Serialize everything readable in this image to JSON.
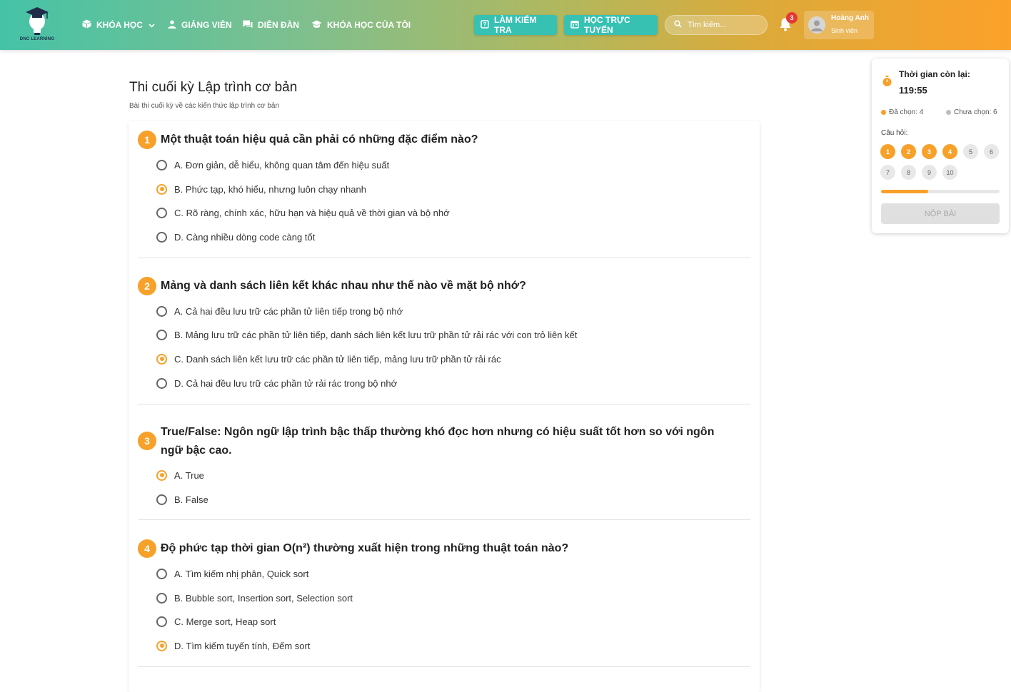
{
  "header": {
    "logo_text": "DNC LEARNING",
    "nav": [
      {
        "label": "KHÓA HỌC",
        "icon": "box-icon",
        "has_dropdown": true
      },
      {
        "label": "GIẢNG VIÊN",
        "icon": "person-icon"
      },
      {
        "label": "DIỄN ĐÀN",
        "icon": "forum-icon"
      },
      {
        "label": "KHÓA HỌC CỦA TÔI",
        "icon": "school-icon"
      }
    ],
    "test_button": "LÀM KIỂM TRA",
    "online_button": "HỌC TRỰC TUYẾN",
    "search_placeholder": "Tìm kiếm...",
    "notifications_count": "3",
    "user": {
      "name": "Hoàng Anh",
      "role": "Sinh viên"
    }
  },
  "exam": {
    "title": "Thi cuối kỳ Lập trình cơ bản",
    "subtitle": "Bài thi cuối kỳ về các kiến thức lập trình cơ bản"
  },
  "questions": [
    {
      "num": "1",
      "text": "Một thuật toán hiệu quả cần phải có những đặc điểm nào?",
      "options": [
        "A. Đơn giản, dễ hiểu, không quan tâm đến hiệu suất",
        "B. Phức tạp, khó hiểu, nhưng luôn chạy nhanh",
        "C. Rõ ràng, chính xác, hữu hạn và hiệu quả về thời gian và bộ nhớ",
        "D. Càng nhiều dòng code càng tốt"
      ],
      "selected": 1
    },
    {
      "num": "2",
      "text": "Mảng và danh sách liên kết khác nhau như thế nào về mặt bộ nhớ?",
      "options": [
        "A. Cả hai đều lưu trữ các phần tử liên tiếp trong bộ nhớ",
        "B. Mảng lưu trữ các phần tử liên tiếp, danh sách liên kết lưu trữ phần tử rải rác với con trỏ liên kết",
        "C. Danh sách liên kết lưu trữ các phần tử liên tiếp, mảng lưu trữ phần tử rải rác",
        "D. Cả hai đều lưu trữ các phần tử rải rác trong bộ nhớ"
      ],
      "selected": 2
    },
    {
      "num": "3",
      "text": "True/False: Ngôn ngữ lập trình bậc thấp thường khó đọc hơn nhưng có hiệu suất tốt hơn so với ngôn ngữ bậc cao.",
      "options": [
        "A. True",
        "B. False"
      ],
      "selected": 0
    },
    {
      "num": "4",
      "text": "Độ phức tạp thời gian O(n²) thường xuất hiện trong những thuật toán nào?",
      "options": [
        "A. Tìm kiếm nhị phân, Quick sort",
        "B. Bubble sort, Insertion sort, Selection sort",
        "C. Merge sort, Heap sort",
        "D. Tìm kiếm tuyến tính, Đếm sort"
      ],
      "selected": 3
    }
  ],
  "panel": {
    "time_label": "Thời gian còn lại:",
    "time_value": "119:55",
    "answered_label": "Đã chọn: 4",
    "unanswered_label": "Chưa chọn: 6",
    "questions_label": "Câu hỏi:",
    "question_numbers": [
      "1",
      "2",
      "3",
      "4",
      "5",
      "6",
      "7",
      "8",
      "9",
      "10"
    ],
    "answered_count": 4,
    "progress_fraction": 0.4,
    "submit_label": "NỘP BÀI"
  },
  "colors": {
    "accent": "#f7a12a",
    "teal": "#36c1b3"
  }
}
